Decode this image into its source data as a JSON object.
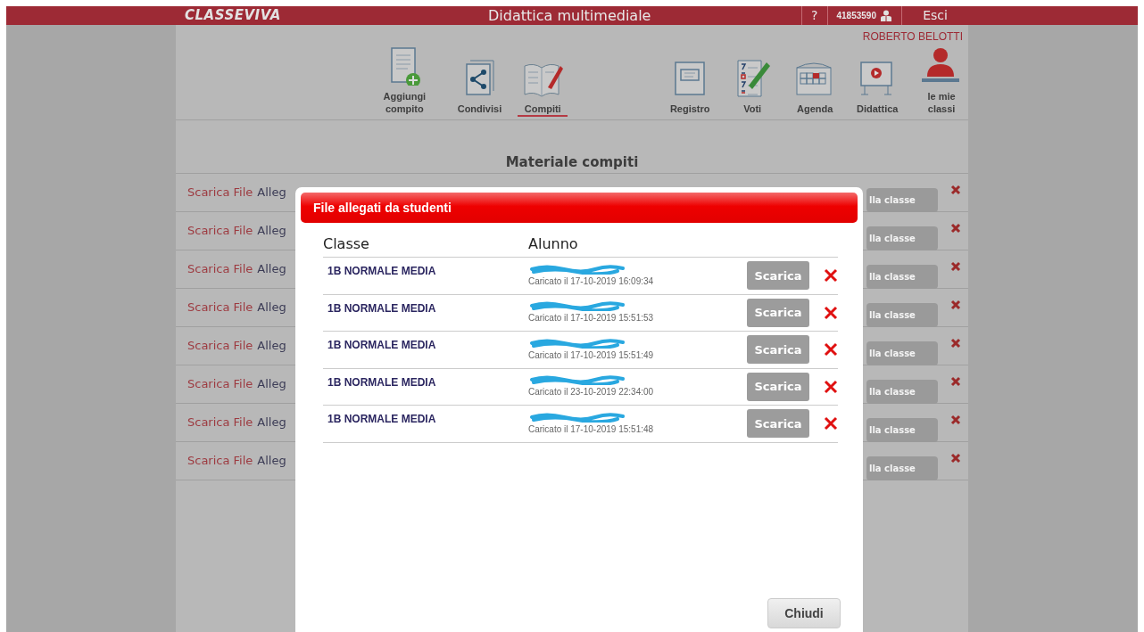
{
  "header": {
    "logo": "CLASSEVIVA",
    "title": "Didattica multimediale",
    "help": "?",
    "user_code": "41853590",
    "logout": "Esci"
  },
  "user_name": "ROBERTO BELOTTI",
  "toolbar": [
    {
      "label": "Aggiungi compito",
      "selected": false
    },
    {
      "label": "Condivisi",
      "selected": false
    },
    {
      "label": "Compiti",
      "selected": true
    },
    {
      "label": "Registro",
      "selected": false
    },
    {
      "label": "Voti",
      "selected": false
    },
    {
      "label": "Agenda",
      "selected": false
    },
    {
      "label": "Didattica",
      "selected": false
    },
    {
      "label": "le mie classi",
      "selected": false
    }
  ],
  "section_title": "Materiale compiti",
  "materials": [
    {
      "download": "Scarica File",
      "attach": "Alleg",
      "class_button": "lla classe"
    },
    {
      "download": "Scarica File",
      "attach": "Alleg",
      "class_button": "lla classe"
    },
    {
      "download": "Scarica File",
      "attach": "Alleg",
      "class_button": "lla classe"
    },
    {
      "download": "Scarica File",
      "attach": "Alleg",
      "class_button": "lla classe"
    },
    {
      "download": "Scarica File",
      "attach": "Alleg",
      "class_button": "lla classe"
    },
    {
      "download": "Scarica File",
      "attach": "Alleg",
      "class_button": "lla classe"
    },
    {
      "download": "Scarica File",
      "attach": "Alleg",
      "class_button": "lla classe"
    },
    {
      "download": "Scarica File",
      "attach": "Alleg",
      "class_button": "lla classe"
    }
  ],
  "dialog": {
    "title": "File allegati da studenti",
    "columns": [
      "Classe",
      "Alunno"
    ],
    "rows": [
      {
        "class": "1B NORMALE MEDIA",
        "uploaded": "Caricato il 17-10-2019 16:09:34",
        "download": "Scarica"
      },
      {
        "class": "1B NORMALE MEDIA",
        "uploaded": "Caricato il 17-10-2019 15:51:53",
        "download": "Scarica"
      },
      {
        "class": "1B NORMALE MEDIA",
        "uploaded": "Caricato il 17-10-2019 15:51:49",
        "download": "Scarica"
      },
      {
        "class": "1B NORMALE MEDIA",
        "uploaded": "Caricato il 23-10-2019 22:34:00",
        "download": "Scarica"
      },
      {
        "class": "1B NORMALE MEDIA",
        "uploaded": "Caricato il 17-10-2019 15:51:48",
        "download": "Scarica"
      }
    ],
    "close": "Chiudi"
  }
}
